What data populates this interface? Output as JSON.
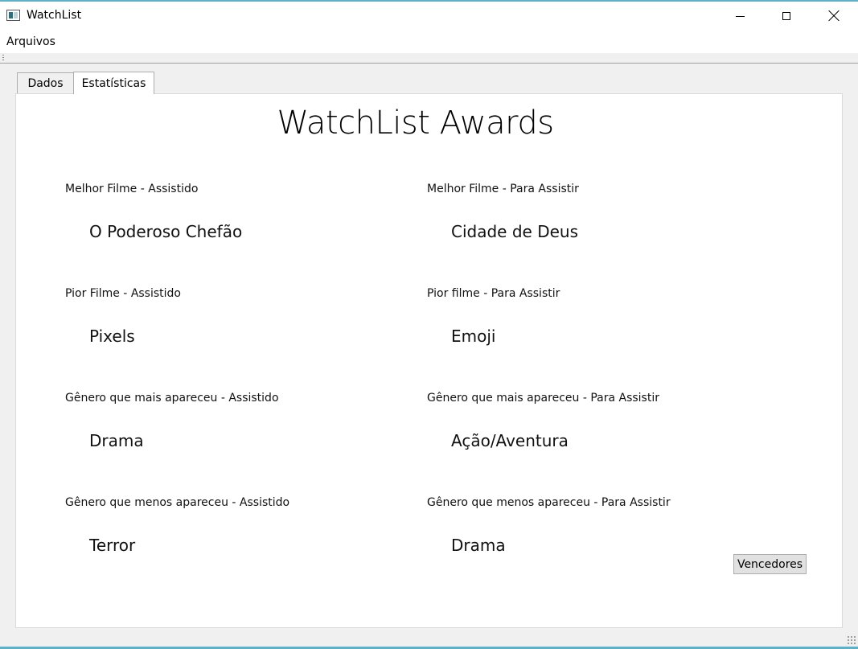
{
  "window": {
    "title": "WatchList"
  },
  "menu": {
    "items": [
      "Arquivos"
    ]
  },
  "tabs": [
    {
      "label": "Dados",
      "selected": false
    },
    {
      "label": "Estatísticas",
      "selected": true
    }
  ],
  "main": {
    "title": "WatchList Awards",
    "stats": [
      {
        "label": "Melhor Filme - Assistido",
        "value": "O Poderoso Chefão"
      },
      {
        "label": "Melhor Filme - Para Assistir",
        "value": "Cidade de Deus"
      },
      {
        "label": "Pior Filme - Assistido",
        "value": "Pixels"
      },
      {
        "label": "Pior filme - Para Assistir",
        "value": "Emoji"
      },
      {
        "label": "Gênero que mais apareceu - Assistido",
        "value": "Drama"
      },
      {
        "label": "Gênero que mais apareceu - Para Assistir",
        "value": "Ação/Aventura"
      },
      {
        "label": "Gênero que menos apareceu - Assistido",
        "value": "Terror"
      },
      {
        "label": "Gênero que menos apareceu - Para Assistir",
        "value": "Drama"
      }
    ],
    "button_label": "Vencedores"
  },
  "icons": {
    "app": "app-window-icon",
    "minimize": "minimize-icon",
    "maximize": "maximize-icon",
    "close": "close-icon"
  },
  "colors": {
    "accent": "#5fb2c6",
    "panel": "#ffffff",
    "chrome": "#f0f0f0"
  }
}
